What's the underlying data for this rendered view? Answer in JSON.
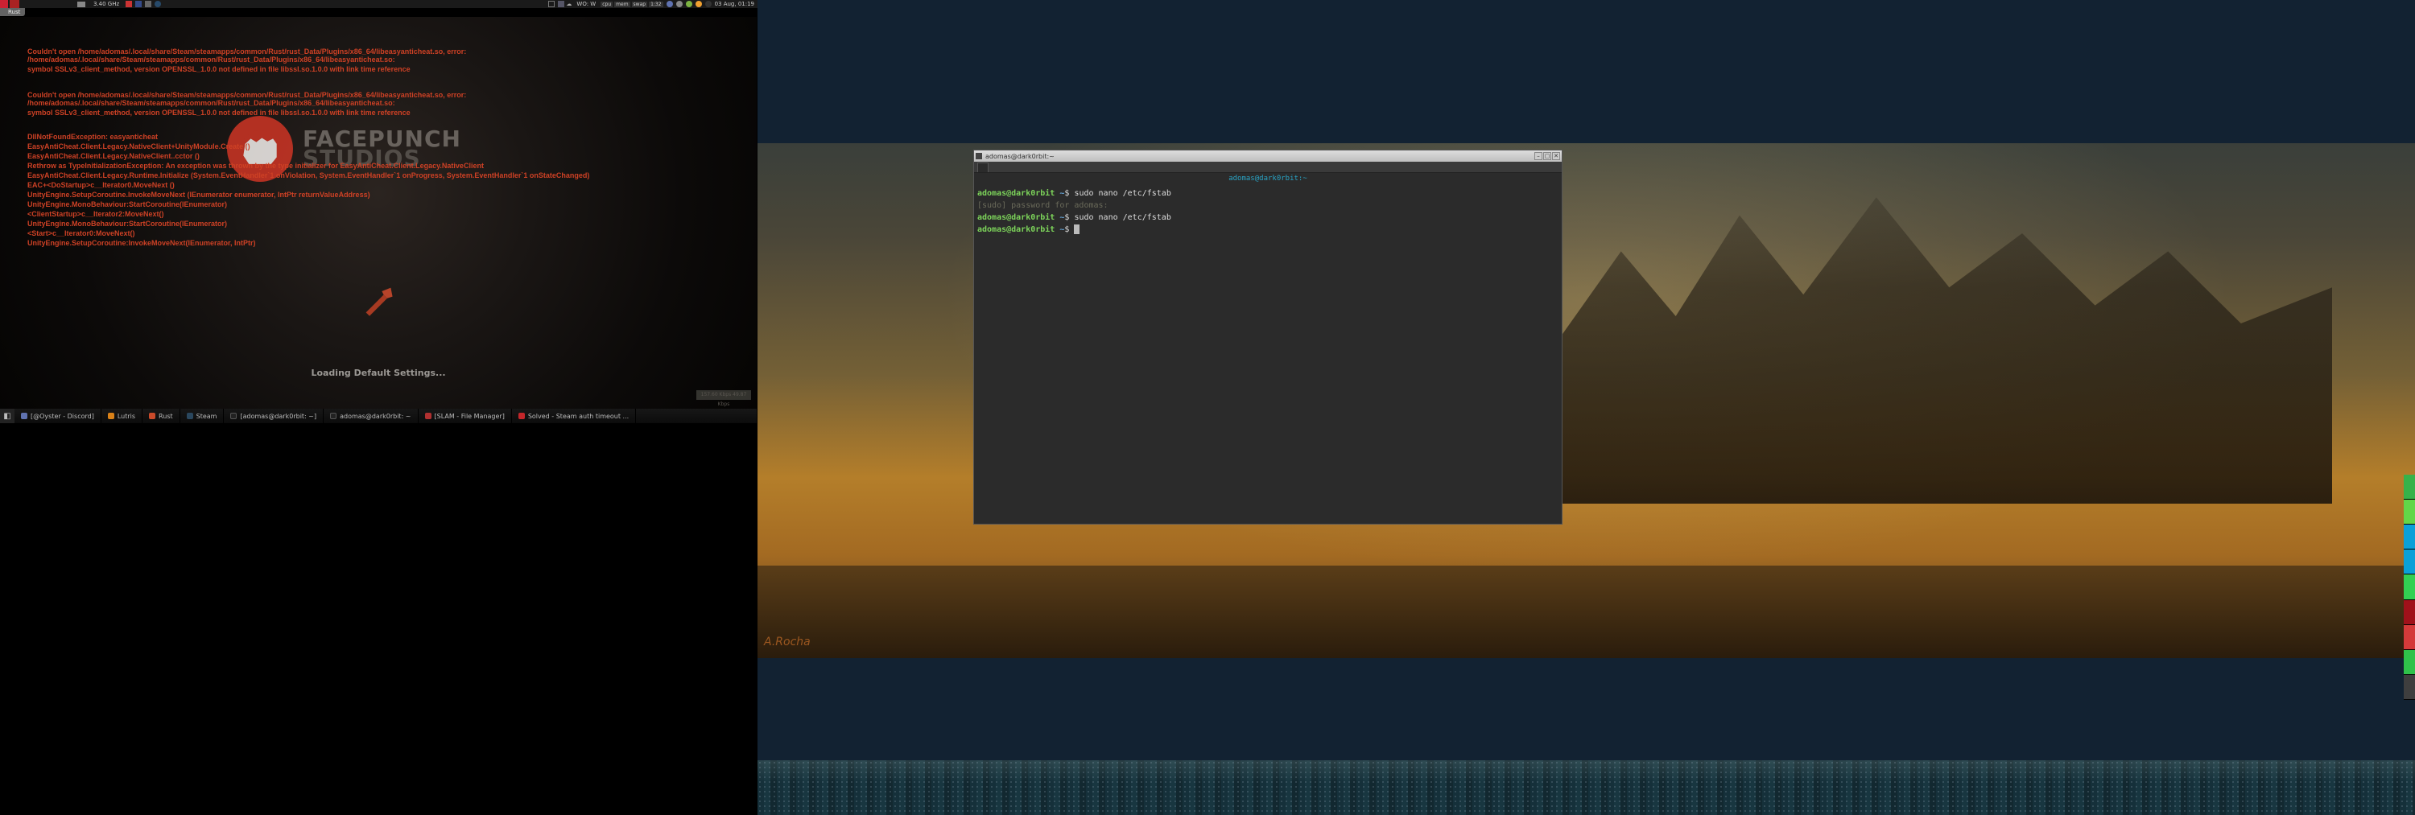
{
  "top_panel": {
    "cpu_freq": "3.40 GHz",
    "weather": "WO: W",
    "sys": [
      "cpu",
      "mem",
      "swap",
      "1:32"
    ],
    "clock": "03 Aug, 01:19"
  },
  "title_tab": "Rust",
  "errors": {
    "block1": [
      "Couldn't open /home/adomas/.local/share/Steam/steamapps/common/Rust/rust_Data/Plugins/x86_64/libeasyanticheat.so, error: /home/adomas/.local/share/Steam/steamapps/common/Rust/rust_Data/Plugins/x86_64/libeasyanticheat.so:",
      "symbol SSLv3_client_method, version OPENSSL_1.0.0 not defined in file libssl.so.1.0.0 with link time reference"
    ],
    "block2": [
      "Couldn't open /home/adomas/.local/share/Steam/steamapps/common/Rust/rust_Data/Plugins/x86_64/libeasyanticheat.so, error: /home/adomas/.local/share/Steam/steamapps/common/Rust/rust_Data/Plugins/x86_64/libeasyanticheat.so:",
      "symbol SSLv3_client_method, version OPENSSL_1.0.0 not defined in file libssl.so.1.0.0 with link time reference"
    ],
    "block3": [
      "DllNotFoundException: easyanticheat",
      "EasyAntiCheat.Client.Legacy.NativeClient+UnityModule.Create ()",
      "EasyAntiCheat.Client.Legacy.NativeClient..cctor ()",
      "Rethrow as TypeInitializationException: An exception was thrown by the type initializer for EasyAntiCheat.Client.Legacy.NativeClient",
      "EasyAntiCheat.Client.Legacy.Runtime.Initialize (System.EventHandler`1 onViolation, System.EventHandler`1 onProgress, System.EventHandler`1 onStateChanged)",
      "EAC+<DoStartup>c__Iterator0.MoveNext ()",
      "UnityEngine.SetupCoroutine.InvokeMoveNext (IEnumerator enumerator, IntPtr returnValueAddress)",
      "UnityEngine.MonoBehaviour:StartCoroutine(IEnumerator)",
      "<ClientStartup>c__Iterator2:MoveNext()",
      "UnityEngine.MonoBehaviour:StartCoroutine(IEnumerator)",
      "<Start>c__Iterator0:MoveNext()",
      "UnityEngine.SetupCoroutine:InvokeMoveNext(IEnumerator, IntPtr)"
    ]
  },
  "logo": {
    "line1": "FACEPUNCH",
    "line2": "STUDIOS"
  },
  "loading": "Loading Default Settings...",
  "net_stats": "157.60 Kbps 49.87 Kbps",
  "taskbar_m1": [
    {
      "label": "[@Oyster - Discord]",
      "cls": "c-discord"
    },
    {
      "label": "Lutris",
      "cls": "c-lutris"
    },
    {
      "label": "Rust",
      "cls": "c-rust"
    },
    {
      "label": "Steam",
      "cls": "c-steam"
    },
    {
      "label": "[adomas@dark0rbit: ~]",
      "cls": "c-term"
    },
    {
      "label": "adomas@dark0rbit: ~",
      "cls": "c-term"
    },
    {
      "label": "[SLAM - File Manager]",
      "cls": "c-fm"
    },
    {
      "label": "Solved - Steam auth timeout ...",
      "cls": "c-v"
    }
  ],
  "terminal": {
    "title": "adomas@dark0rbit:~",
    "center_title": "adomas@dark0rbit:~",
    "user": "adomas@dark0rbit",
    "path": "~",
    "lines": [
      {
        "cmd": "sudo nano /etc/fstab"
      },
      {
        "sudo": "[sudo] password for adomas:"
      },
      {
        "cmd": "sudo nano /etc/fstab"
      },
      {
        "cmd": ""
      }
    ]
  },
  "artist_sig": "A.Rocha"
}
